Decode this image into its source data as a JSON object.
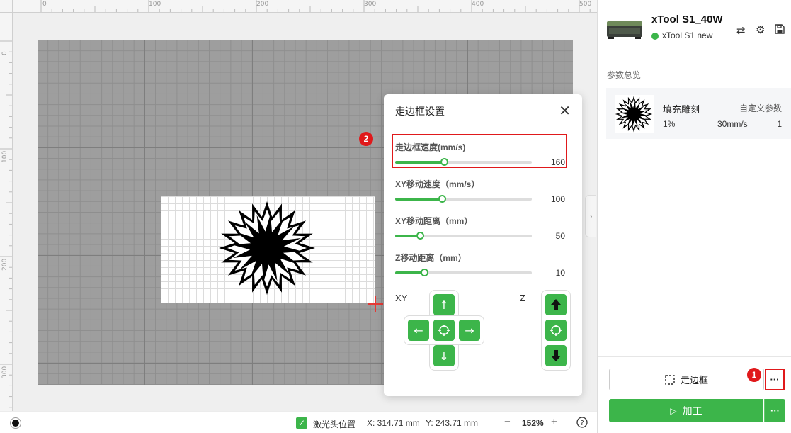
{
  "ruler": {
    "top_ticks": [
      "0",
      "100",
      "200",
      "300",
      "400",
      "500"
    ],
    "left_ticks": [
      "0",
      "100",
      "200",
      "300"
    ]
  },
  "popup": {
    "title": "走边框设置",
    "sliders": [
      {
        "label": "走边框速度(mm/s)",
        "value": "160",
        "level": 0.36
      },
      {
        "label": "XY移动速度（mm/s）",
        "value": "100",
        "level": 0.34
      },
      {
        "label": "XY移动距离（mm）",
        "value": "50",
        "level": 0.18
      },
      {
        "label": "Z移动距离（mm）",
        "value": "10",
        "level": 0.21
      }
    ],
    "xy_label": "XY",
    "z_label": "Z"
  },
  "badges": {
    "one": "1",
    "two": "2"
  },
  "device": {
    "name": "xTool S1_40W",
    "status": "xTool S1 new",
    "status_color": "#3cb54a"
  },
  "params": {
    "section_title": "参数总览",
    "mode": "填充雕刻",
    "custom_label": "自定义参数",
    "power": "1%",
    "speed": "30mm/s",
    "passes": "1"
  },
  "actions": {
    "frame_label": "走边框",
    "more_label": "···",
    "process_label": "加工",
    "process_more_label": "···"
  },
  "bottom": {
    "laser_pos_label": "激光头位置",
    "x_readout": "X: 314.71 mm",
    "y_readout": "Y: 243.71 mm",
    "zoom": "152%"
  },
  "colors": {
    "accent": "#3cb54a",
    "highlight": "#e0191b"
  }
}
